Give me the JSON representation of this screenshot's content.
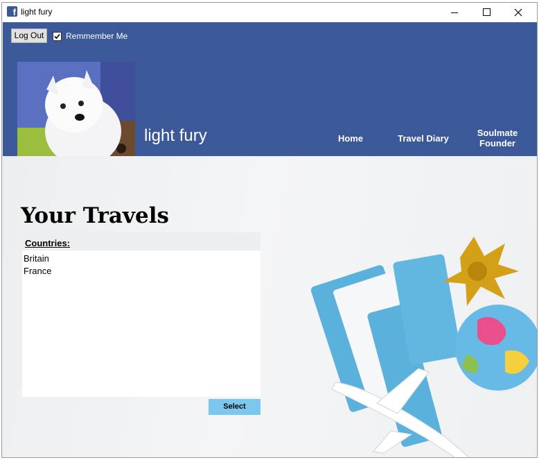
{
  "window": {
    "title": "light fury",
    "app_icon_glyph": "f",
    "controls": [
      "minimize-icon",
      "maximize-icon",
      "close-icon"
    ]
  },
  "header": {
    "logout_label": "Log Out",
    "remember_label": "Remmember Me",
    "remember_checked": true,
    "brand_name": "light fury",
    "nav": {
      "home": "Home",
      "travel_diary": "Travel Diary",
      "soulmate_line1": "Soulmate",
      "soulmate_line2": "Founder"
    },
    "background_color": "#3b5998"
  },
  "main": {
    "heading": "Your Travels",
    "countries_header": "Countries:",
    "countries": [
      "Britain",
      "France"
    ],
    "select_label": "Select",
    "select_color": "#7cc7ee"
  }
}
